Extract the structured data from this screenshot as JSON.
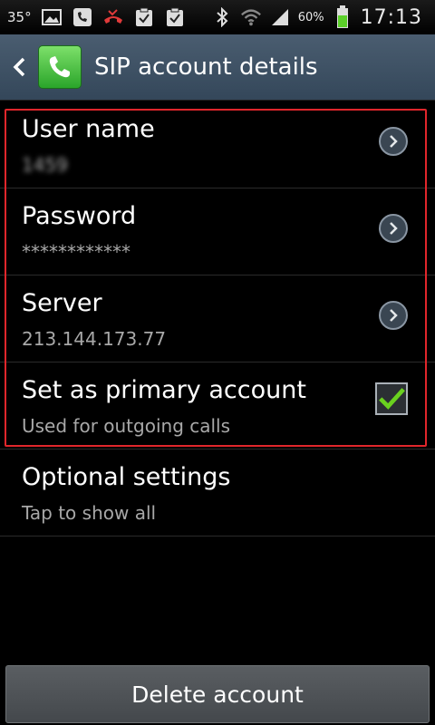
{
  "statusbar": {
    "temperature": "35°",
    "battery_percent": "60%",
    "time": "17:13",
    "icons": [
      "photo-icon",
      "sip-phone-icon",
      "missed-call-icon",
      "clipboard-check-icon",
      "clipboard-check-icon",
      "bluetooth-icon",
      "wifi-icon",
      "signal-icon",
      "battery-icon"
    ]
  },
  "actionbar": {
    "title": "SIP account details",
    "icon": "phone-app-icon"
  },
  "settings": [
    {
      "label": "User name",
      "value": "1459",
      "control": "chevron"
    },
    {
      "label": "Password",
      "value": "************",
      "control": "chevron"
    },
    {
      "label": "Server",
      "value": "213.144.173.77",
      "control": "chevron"
    },
    {
      "label": "Set as primary account",
      "value": "Used for outgoing calls",
      "control": "checkbox",
      "checked": true
    },
    {
      "label": "Optional settings",
      "value": "Tap to show all",
      "control": "none"
    }
  ],
  "footer": {
    "delete_label": "Delete account"
  },
  "colors": {
    "actionbar": "#3f5367",
    "highlight_border": "#e0262b",
    "checkmark": "#6ad11f",
    "battery": "#5cd12a"
  }
}
